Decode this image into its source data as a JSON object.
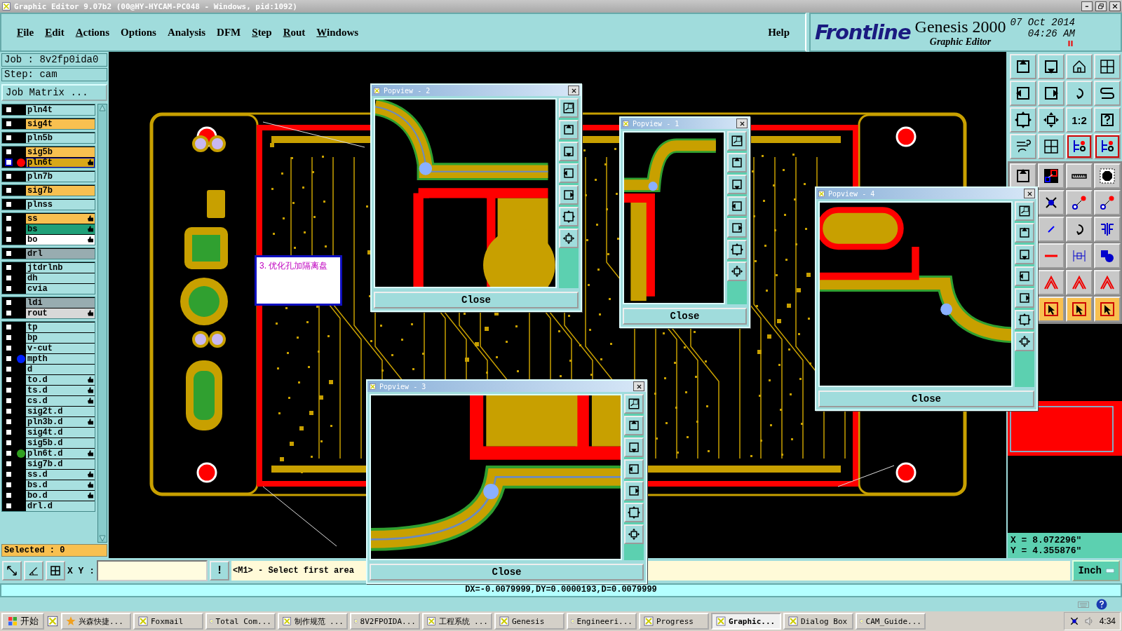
{
  "window": {
    "title": "Graphic Editor 9.07b2 (00@HY-HYCAM-PC048 - Windows, pid:1092)"
  },
  "menu": [
    {
      "label": "File",
      "mnemonic": true
    },
    {
      "label": "Edit",
      "mnemonic": true
    },
    {
      "label": "Actions",
      "mnemonic": true
    },
    {
      "label": "Options",
      "mnemonic": false
    },
    {
      "label": "Analysis",
      "mnemonic": false
    },
    {
      "label": "DFM",
      "mnemonic": false
    },
    {
      "label": "Step",
      "mnemonic": true
    },
    {
      "label": "Rout",
      "mnemonic": true
    },
    {
      "label": "Windows",
      "mnemonic": true
    }
  ],
  "help": "Help",
  "brand": {
    "logo": "Frontline",
    "product": "Genesis 2000",
    "subtitle": "Graphic Editor",
    "date": "07 Oct 2014",
    "time": "04:26 AM"
  },
  "job": {
    "job": "Job : 8v2fp0ida0",
    "step": "Step: cam",
    "matrix_button": "Job Matrix ..."
  },
  "layer_groups": [
    {
      "layers": [
        {
          "name": "pln4t",
          "kind": "misc",
          "selected": false,
          "checked": false,
          "hand": false
        }
      ]
    },
    {
      "layers": [
        {
          "name": "sig4t",
          "kind": "signal",
          "selected": false,
          "checked": false,
          "hand": false
        }
      ]
    },
    {
      "layers": [
        {
          "name": "pln5b",
          "kind": "misc",
          "selected": false,
          "checked": false,
          "hand": false
        }
      ]
    },
    {
      "layers": [
        {
          "name": "sig5b",
          "kind": "signal",
          "selected": false,
          "checked": false,
          "hand": false
        },
        {
          "name": "pln6t",
          "kind": "work",
          "selected": true,
          "checked": false,
          "hand": true,
          "color": "#ff0000"
        }
      ]
    },
    {
      "layers": [
        {
          "name": "pln7b",
          "kind": "misc",
          "selected": false,
          "checked": false,
          "hand": false
        }
      ]
    },
    {
      "layers": [
        {
          "name": "sig7b",
          "kind": "signal",
          "selected": false,
          "checked": false,
          "hand": false
        }
      ]
    },
    {
      "layers": [
        {
          "name": "plnss",
          "kind": "misc",
          "selected": false,
          "checked": false,
          "hand": false
        }
      ]
    },
    {
      "layers": [
        {
          "name": "ss",
          "kind": "signal",
          "selected": false,
          "checked": false,
          "hand": true
        },
        {
          "name": "bs",
          "kind": "mask",
          "selected": false,
          "checked": false,
          "hand": true
        },
        {
          "name": "bo",
          "kind": "silk",
          "selected": false,
          "checked": false,
          "hand": true
        }
      ]
    },
    {
      "layers": [
        {
          "name": "drl",
          "kind": "drill",
          "selected": false,
          "checked": false,
          "hand": false
        }
      ]
    },
    {
      "layers": [
        {
          "name": "jtdrlnb",
          "kind": "misc",
          "selected": false,
          "checked": false,
          "hand": false
        },
        {
          "name": "dh",
          "kind": "misc",
          "selected": false,
          "checked": false,
          "hand": false
        },
        {
          "name": "cvia",
          "kind": "misc",
          "selected": false,
          "checked": false,
          "hand": false
        }
      ]
    },
    {
      "layers": [
        {
          "name": "ldi",
          "kind": "drill",
          "selected": false,
          "checked": false,
          "hand": false
        },
        {
          "name": "rout",
          "kind": "rout",
          "selected": false,
          "checked": false,
          "hand": true
        }
      ]
    },
    {
      "layers": [
        {
          "name": "tp",
          "kind": "misc",
          "selected": false,
          "checked": false,
          "hand": false
        },
        {
          "name": "bp",
          "kind": "misc",
          "selected": false,
          "checked": false,
          "hand": false
        },
        {
          "name": "v-cut",
          "kind": "misc",
          "selected": false,
          "checked": false,
          "hand": false
        },
        {
          "name": "mpth",
          "kind": "misc",
          "selected": false,
          "checked": false,
          "hand": false,
          "color": "#0020ff"
        },
        {
          "name": "d",
          "kind": "misc",
          "selected": false,
          "checked": false,
          "hand": false
        },
        {
          "name": "to.d",
          "kind": "misc",
          "selected": false,
          "checked": false,
          "hand": true
        },
        {
          "name": "ts.d",
          "kind": "misc",
          "selected": false,
          "checked": false,
          "hand": true
        },
        {
          "name": "cs.d",
          "kind": "misc",
          "selected": false,
          "checked": false,
          "hand": true
        },
        {
          "name": "sig2t.d",
          "kind": "misc",
          "selected": false,
          "checked": false,
          "hand": false
        },
        {
          "name": "pln3b.d",
          "kind": "misc",
          "selected": false,
          "checked": false,
          "hand": true
        },
        {
          "name": "sig4t.d",
          "kind": "misc",
          "selected": false,
          "checked": false,
          "hand": false
        },
        {
          "name": "sig5b.d",
          "kind": "misc",
          "selected": false,
          "checked": false,
          "hand": false
        },
        {
          "name": "pln6t.d",
          "kind": "misc",
          "selected": false,
          "checked": false,
          "hand": true,
          "color": "#30a020"
        },
        {
          "name": "sig7b.d",
          "kind": "misc",
          "selected": false,
          "checked": false,
          "hand": false
        },
        {
          "name": "ss.d",
          "kind": "misc",
          "selected": false,
          "checked": false,
          "hand": true
        },
        {
          "name": "bs.d",
          "kind": "misc",
          "selected": false,
          "checked": false,
          "hand": true
        },
        {
          "name": "bo.d",
          "kind": "misc",
          "selected": false,
          "checked": false,
          "hand": true
        },
        {
          "name": "drl.d",
          "kind": "misc",
          "selected": false,
          "checked": false,
          "hand": false
        }
      ]
    }
  ],
  "selected_count": "Selected : 0",
  "annotation": "3. 优化孔加隔离盘",
  "popviews": [
    {
      "title": "Popview - 2",
      "close": "Close"
    },
    {
      "title": "Popview - 1",
      "close": "Close"
    },
    {
      "title": "Popview - 4",
      "close": "Close"
    },
    {
      "title": "Popview - 3",
      "close": "Close"
    }
  ],
  "ratio_button": "1:2",
  "coordinates": {
    "x": "X = 8.072296\"",
    "y": "Y = 4.355876\""
  },
  "command": {
    "label": "X Y :",
    "exclaim_button": "!",
    "prompt": "<M1> - Select first area",
    "unit": "Inch"
  },
  "status": "DX=-0.0079999,DY=0.0000193,D=0.0079999",
  "taskbar": {
    "start": "开始",
    "items": [
      {
        "label": "兴森快捷...",
        "selected": false
      },
      {
        "label": "Foxmail",
        "selected": false
      },
      {
        "label": "Total Com...",
        "selected": false
      },
      {
        "label": "制作规范 ...",
        "selected": false
      },
      {
        "label": "8V2FPOIDA...",
        "selected": false
      },
      {
        "label": "工程系统 ...",
        "selected": false
      },
      {
        "label": "Genesis",
        "selected": false
      },
      {
        "label": "Engineeri...",
        "selected": false
      },
      {
        "label": "Progress",
        "selected": false
      },
      {
        "label": "Graphic...",
        "selected": true
      },
      {
        "label": "Dialog Box",
        "selected": false
      },
      {
        "label": "CAM_Guide...",
        "selected": false
      }
    ],
    "clock": "4:34"
  }
}
